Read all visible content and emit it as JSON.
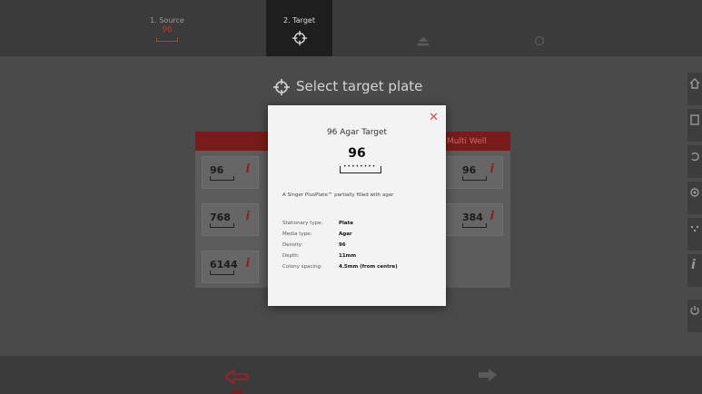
{
  "stepper": {
    "step1_label": "1. Source",
    "step1_value": "96",
    "step2_label": "2. Target"
  },
  "page": {
    "title": "Select target plate",
    "panel_header_right": "Multi Well"
  },
  "tiles": [
    {
      "value": "96"
    },
    {
      "value": "768"
    },
    {
      "value": "6144"
    },
    {
      "value": "96"
    },
    {
      "value": "384"
    }
  ],
  "modal": {
    "title": "96 Agar Target",
    "density_value": "96",
    "description": "A Singer PlusPlate™ partially filled with agar",
    "close_symbol": "✕",
    "properties": [
      {
        "key": "Stationary type:",
        "value": "Plate"
      },
      {
        "key": "Media type:",
        "value": "Agar"
      },
      {
        "key": "Density:",
        "value": "96"
      },
      {
        "key": "Depth:",
        "value": "11mm"
      },
      {
        "key": "Colony spacing:",
        "value": "4.5mm (from centre)"
      }
    ]
  },
  "icons": [
    "target-icon",
    "home-icon",
    "document-icon",
    "undo-icon",
    "settings-icon",
    "dots-icon",
    "info-icon",
    "power-icon",
    "back-arrow-icon",
    "next-arrow-icon"
  ],
  "colors": {
    "accent_red": "#c0392b",
    "panel_header": "#7a1a1a",
    "background": "#4a4a4a"
  }
}
